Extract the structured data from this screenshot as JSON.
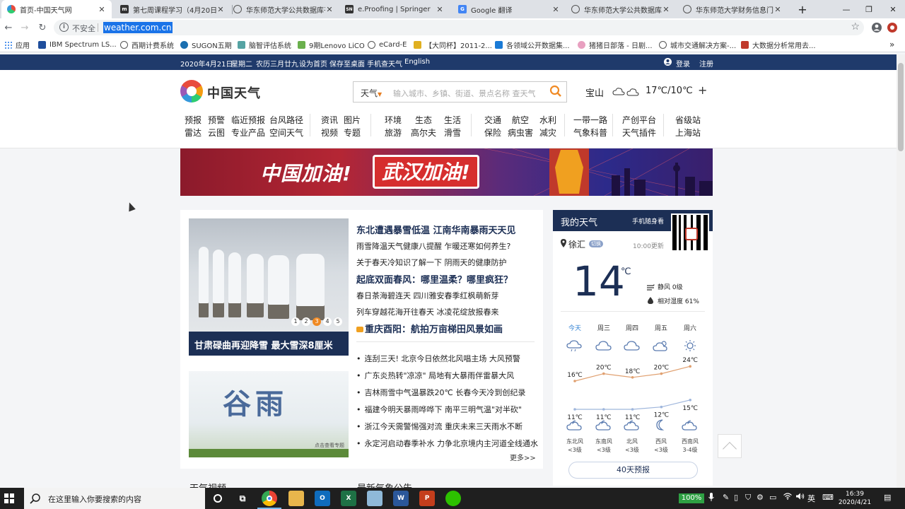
{
  "browser": {
    "tabs": [
      {
        "title": "首页-中国天气网",
        "active": true
      },
      {
        "title": "第七周课程学习（4月20日",
        "active": false
      },
      {
        "title": "华东师范大学公共数据库平",
        "active": false
      },
      {
        "title": "e.Proofing | Springer",
        "active": false
      },
      {
        "title": "Google 翻译",
        "active": false
      },
      {
        "title": "华东师范大学公共数据库平",
        "active": false
      },
      {
        "title": "华东师范大学财务信息门户",
        "active": false
      }
    ],
    "new_tab": "+",
    "window_controls": [
      "—",
      "❐",
      "✕"
    ],
    "security_label": "不安全",
    "url": "weather.com.cn",
    "bookmarks": [
      {
        "label": "应用"
      },
      {
        "label": "IBM Spectrum LS..."
      },
      {
        "label": "西期计费系统"
      },
      {
        "label": "SUGON五期"
      },
      {
        "label": "脑智评估系统"
      },
      {
        "label": "9期Lenovo LiCO"
      },
      {
        "label": "eCard-E"
      },
      {
        "label": "【大同杯】2011-2..."
      },
      {
        "label": "各领域公开数据集..."
      },
      {
        "label": "猪猪日部落 - 日剧..."
      },
      {
        "label": "城市交通解决方案-..."
      },
      {
        "label": "大数据分析常用去..."
      }
    ]
  },
  "site": {
    "topbar": {
      "links": [
        "2020年4月21日",
        "星期二",
        "农历三月廿九",
        "设为首页",
        "保存至桌面",
        "手机查天气",
        "English"
      ],
      "login": "登录",
      "register": "注册"
    },
    "logo_text": "中国天气",
    "search": {
      "type": "天气",
      "placeholder": "输入城市、乡镇、街道、景点名称 查天气"
    },
    "header_weather": {
      "city": "宝山",
      "temp": "17℃/10℃",
      "add": "+"
    },
    "nav": {
      "groups": [
        {
          "row1": [
            "预报",
            "预警",
            "临近预报",
            "台风路径"
          ],
          "row2": [
            "雷达",
            "云图",
            "专业产品",
            "空间天气"
          ]
        },
        {
          "row1": [
            "资讯",
            "图片"
          ],
          "row2": [
            "视频",
            "专题"
          ]
        },
        {
          "row1": [
            "环境",
            "生态",
            "生活"
          ],
          "row2": [
            "旅游",
            "高尔夫",
            "滑雪"
          ]
        },
        {
          "row1": [
            "交通",
            "航空",
            "水利"
          ],
          "row2": [
            "保险",
            "病虫害",
            "减灾"
          ]
        },
        {
          "row1": [
            "一带一路"
          ],
          "row2": [
            "气象科普"
          ]
        },
        {
          "row1": [
            "产创平台"
          ],
          "row2": [
            "天气插件"
          ]
        },
        {
          "row1": [
            "省级站"
          ],
          "row2": [
            "上海站"
          ]
        }
      ]
    },
    "banner": {
      "text1": "中国加油!",
      "text2": "武汉加油!"
    },
    "news": {
      "image1_caption": "甘肃碌曲再迎降雪 最大雪深8厘米",
      "slides": [
        "1",
        "2",
        "3",
        "4",
        "5"
      ],
      "image2_title": "谷雨",
      "image2_more": "点击查看专题",
      "headline1": "东北遭遇暴雪低温 江南华南暴雨天天见",
      "lines1": [
        "雨雪降温天气健康八提醒 乍暖还寒如何养生?",
        "关于春天冷知识了解一下 阴雨天的健康防护"
      ],
      "headline2": "起底双面春风：哪里温柔？哪里疯狂？",
      "lines2": [
        "春日茶海碧连天 四川雅安春季红枫萌新芽",
        "列车穿越花海开往春天 冰凌花绽放报春来"
      ],
      "headline3": "重庆酉阳：航拍万亩梯田风景如画",
      "bullets": [
        "连刮三天! 北京今日依然北风唱主场  大风预警",
        "广东炎热转\"凉凉\"  局地有大暴雨伴雷暴大风",
        "吉林雨雪中气温暴跌20℃ 长春今天冷到创纪录",
        "福建今明天暴雨哗哗下 南平三明气温\"对半砍\"",
        "浙江今天需警惕强对流  重庆未来三天雨水不断",
        "永定河启动春季补水 力争北京境内主河道全线通水"
      ],
      "more": "更多>>"
    },
    "my_weather": {
      "title": "我的天气",
      "mobile": "手机随身看",
      "city": "徐汇",
      "switch": "切换",
      "updated": "10:00更新",
      "temp": "14",
      "unit": "℃",
      "wind": "静风  0级",
      "humidity": "相对湿度  61%",
      "days": [
        {
          "day": "今天",
          "high": "16℃",
          "low": "11℃",
          "wind": "东北风",
          "level": "<3级",
          "icon": "showers-icon"
        },
        {
          "day": "周三",
          "high": "20℃",
          "low": "11℃",
          "wind": "东南风",
          "level": "<3级",
          "icon": "cloudy-icon"
        },
        {
          "day": "周四",
          "high": "18℃",
          "low": "11℃",
          "wind": "北风",
          "level": "<3级",
          "icon": "cloudy-icon"
        },
        {
          "day": "周五",
          "high": "20℃",
          "low": "12℃",
          "wind": "西风",
          "level": "<3级",
          "icon": "partly-sunny-icon"
        },
        {
          "day": "周六",
          "high": "24℃",
          "low": "15℃",
          "wind": "西南风",
          "level": "3-4级",
          "icon": "sunny-icon"
        }
      ],
      "forecast_button": "40天预报"
    },
    "sections": [
      "天气视频",
      "最新气象公告"
    ]
  },
  "taskbar": {
    "search_placeholder": "在这里输入你要搜索的内容",
    "battery": "100%",
    "ime": "英",
    "time": "16:39",
    "date": "2020/4/21"
  },
  "colors": {
    "site_navy": "#1f3a6b",
    "accent_orange": "#f08a24",
    "link_blue": "#1c2f55"
  }
}
